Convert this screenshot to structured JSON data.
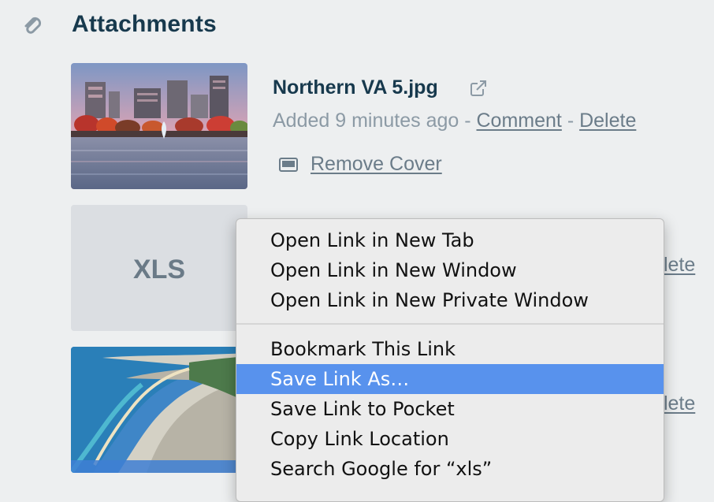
{
  "section": {
    "title": "Attachments",
    "icon": "paperclip-icon"
  },
  "attachments": [
    {
      "name": "Northern VA 5.jpg",
      "added": "Added 9 minutes ago",
      "separator": " - ",
      "comment_label": "Comment",
      "delete_label": "Delete",
      "remove_cover_label": "Remove Cover"
    },
    {
      "thumb_label": "XLS",
      "delete_label_partial": "Delete"
    },
    {
      "delete_label_partial": "Delete"
    }
  ],
  "context_menu": {
    "items": [
      "Open Link in New Tab",
      "Open Link in New Window",
      "Open Link in New Private Window",
      "Bookmark This Link",
      "Save Link As…",
      "Save Link to Pocket",
      "Copy Link Location",
      "Search Google for “xls”"
    ],
    "highlighted_index": 4
  },
  "colors": {
    "background": "#edeff0",
    "title": "#17394d",
    "muted_text": "#8c9aa5",
    "link": "#6b7c89",
    "menu_highlight": "#5892ed",
    "menu_background": "#ececec"
  }
}
